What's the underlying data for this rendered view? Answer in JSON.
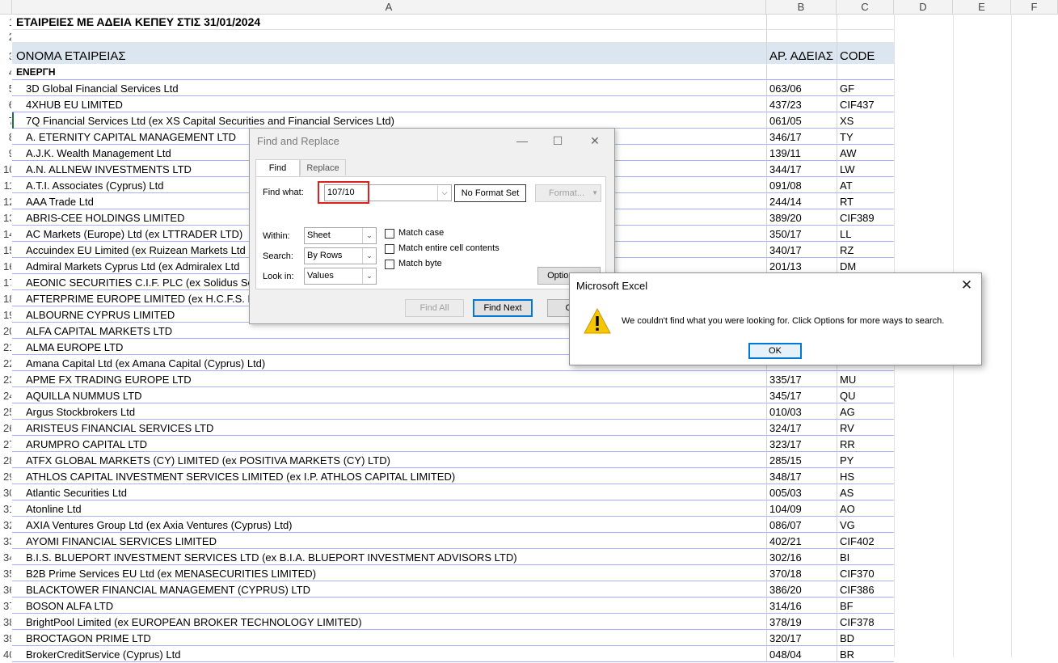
{
  "columns": [
    "A",
    "B",
    "C",
    "D",
    "E",
    "F"
  ],
  "sheet": {
    "title": "ΕΤΑΙΡΕΙΕΣ ΜΕ ΑΔΕΙΑ ΚΕΠΕΥ ΣΤΙΣ 31/01/2024",
    "headers": {
      "name": "ΟΝΟΜΑ ΕΤΑΙΡΕΙΑΣ",
      "license": "ΑΡ. ΑΔΕΙΑΣ",
      "code": "CODE"
    },
    "category": "ΕΝΕΡΓΗ",
    "rows": [
      {
        "num": "5",
        "name": "3D Global Financial Services Ltd",
        "license": "063/06",
        "code": "GF"
      },
      {
        "num": "6",
        "name": "4XHUB EU LIMITED",
        "license": "437/23",
        "code": "CIF437"
      },
      {
        "num": "7",
        "name": "7Q Financial Services Ltd (ex XS Capital Securities and Financial Services Ltd)",
        "license": "061/05",
        "code": "XS"
      },
      {
        "num": "8",
        "name": "A. ETERNITY CAPITAL MANAGEMENT LTD",
        "license": "346/17",
        "code": "TY"
      },
      {
        "num": "9",
        "name": "A.J.K. Wealth Management Ltd",
        "license": "139/11",
        "code": "AW"
      },
      {
        "num": "10",
        "name": "A.N. ALLNEW INVESTMENTS LTD",
        "license": "344/17",
        "code": "LW"
      },
      {
        "num": "11",
        "name": "A.T.I. Associates (Cyprus) Ltd",
        "license": "091/08",
        "code": "AT"
      },
      {
        "num": "12",
        "name": "AAA Trade Ltd",
        "license": "244/14",
        "code": "RT"
      },
      {
        "num": "13",
        "name": "ABRIS-CEE HOLDINGS LIMITED",
        "license": "389/20",
        "code": "CIF389"
      },
      {
        "num": "14",
        "name": "AC Markets (Europe) Ltd (ex LTTRADER LTD)",
        "license": "350/17",
        "code": "LL"
      },
      {
        "num": "15",
        "name": "Accuindex EU Limited (ex Ruizean Markets Ltd",
        "license": "340/17",
        "code": "RZ"
      },
      {
        "num": "16",
        "name": "Admiral Markets Cyprus Ltd (ex Admiralex Ltd",
        "license": "201/13",
        "code": "DM"
      },
      {
        "num": "17",
        "name": "AEONIC SECURITIES C.I.F. PLC (ex Solidus Secu",
        "license": "",
        "code": ""
      },
      {
        "num": "18",
        "name": "AFTERPRIME EUROPE LIMITED (ex H.C.F.S. HIG",
        "license": "",
        "code": ""
      },
      {
        "num": "19",
        "name": "ALBOURNE CYPRUS LIMITED",
        "license": "",
        "code": ""
      },
      {
        "num": "20",
        "name": "ALFA CAPITAL MARKETS LTD",
        "license": "",
        "code": ""
      },
      {
        "num": "21",
        "name": "ALMA EUROPE LTD",
        "license": "",
        "code": ""
      },
      {
        "num": "22",
        "name": "Amana Capital Ltd (ex Amana Capital (Cyprus) Ltd)",
        "license": "",
        "code": ""
      },
      {
        "num": "23",
        "name": "APME FX TRADING EUROPE LTD",
        "license": "335/17",
        "code": "MU"
      },
      {
        "num": "24",
        "name": "AQUILLA NUMMUS LTD",
        "license": "345/17",
        "code": "QU"
      },
      {
        "num": "25",
        "name": "Argus Stockbrokers Ltd",
        "license": "010/03",
        "code": "AG"
      },
      {
        "num": "26",
        "name": "ARISTEUS FINANCIAL SERVICES LTD",
        "license": "324/17",
        "code": "RV"
      },
      {
        "num": "27",
        "name": "ARUMPRO CAPITAL LTD",
        "license": "323/17",
        "code": "RR"
      },
      {
        "num": "28",
        "name": "ATFX GLOBAL MARKETS (CY) LIMITED (ex POSITIVA MARKETS (CY) LTD)",
        "license": "285/15",
        "code": "PY"
      },
      {
        "num": "29",
        "name": "ATHLOS CAPITAL INVESTMENT SERVICES LIMITED (ex I.P. ATHLOS CAPITAL LIMITED)",
        "license": "348/17",
        "code": "HS"
      },
      {
        "num": "30",
        "name": "Atlantic Securities Ltd",
        "license": "005/03",
        "code": "AS"
      },
      {
        "num": "31",
        "name": "Atonline Ltd",
        "license": "104/09",
        "code": "AO"
      },
      {
        "num": "32",
        "name": "AXIA Ventures Group Ltd (ex Axia Ventures (Cyprus) Ltd)",
        "license": "086/07",
        "code": "VG"
      },
      {
        "num": "33",
        "name": "AYOMI FINANCIAL SERVICES LIMITED",
        "license": "402/21",
        "code": "CIF402"
      },
      {
        "num": "34",
        "name": "B.I.S. BLUEPORT INVESTMENT SERVICES LTD (ex B.I.A. BLUEPORT INVESTMENT ADVISORS LTD)",
        "license": "302/16",
        "code": "BI"
      },
      {
        "num": "35",
        "name": "B2B Prime Services EU Ltd (ex MENASECURITIES LIMITED)",
        "license": "370/18",
        "code": "CIF370"
      },
      {
        "num": "36",
        "name": "BLACKTOWER FINANCIAL MANAGEMENT (CYPRUS) LTD",
        "license": "386/20",
        "code": "CIF386"
      },
      {
        "num": "37",
        "name": "BOSON ALFA LTD",
        "license": "314/16",
        "code": "BF"
      },
      {
        "num": "38",
        "name": "BrightPool Limited  (ex EUROPEAN BROKER TECHNOLOGY LIMITED)",
        "license": "378/19",
        "code": "CIF378"
      },
      {
        "num": "39",
        "name": "BROCTAGON PRIME LTD",
        "license": "320/17",
        "code": "BD"
      },
      {
        "num": "40",
        "name": "BrokerCreditService (Cyprus) Ltd",
        "license": "048/04",
        "code": "BR"
      }
    ]
  },
  "find_dialog": {
    "title": "Find and Replace",
    "tab_find": "Find",
    "tab_replace": "Replace",
    "find_what_label": "Find what:",
    "find_what_value": "107/10",
    "no_format": "No Format Set",
    "format_btn": "Format...",
    "within_label": "Within:",
    "within_value": "Sheet",
    "search_label": "Search:",
    "search_value": "By Rows",
    "lookin_label": "Look in:",
    "lookin_value": "Values",
    "match_case": "Match case",
    "match_entire": "Match entire cell contents",
    "match_byte": "Match byte",
    "options_btn": "Options <<",
    "find_all_btn": "Find All",
    "find_next_btn": "Find Next",
    "close_btn": "Close"
  },
  "message_box": {
    "title": "Microsoft Excel",
    "text": "We couldn't find what you were looking for. Click Options for more ways to search.",
    "ok": "OK"
  }
}
